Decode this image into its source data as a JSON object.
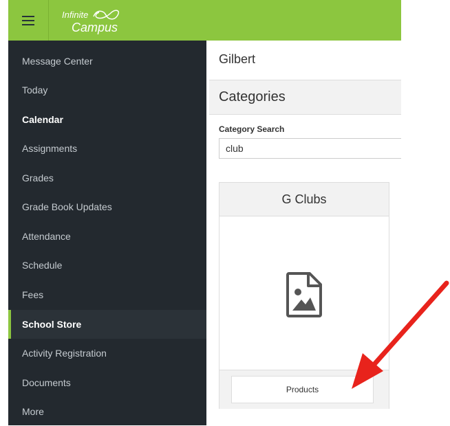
{
  "header": {
    "logo_line1": "Infinite",
    "logo_line2": "Campus",
    "brand_color": "#8cc63f"
  },
  "sidebar": {
    "items": [
      {
        "label": "Message Center"
      },
      {
        "label": "Today"
      },
      {
        "label": "Calendar"
      },
      {
        "label": "Assignments"
      },
      {
        "label": "Grades"
      },
      {
        "label": "Grade Book Updates"
      },
      {
        "label": "Attendance"
      },
      {
        "label": "Schedule"
      },
      {
        "label": "Fees"
      },
      {
        "label": "School Store",
        "active": true
      },
      {
        "label": "Activity Registration"
      },
      {
        "label": "Documents"
      },
      {
        "label": "More"
      }
    ],
    "background_color": "#23292f"
  },
  "main": {
    "school_name": "Gilbert",
    "section_title": "Categories",
    "search": {
      "label": "Category Search",
      "value": "club"
    },
    "card": {
      "title": "G Clubs",
      "image_icon": "image-file-icon",
      "button_label": "Products"
    }
  },
  "annotation": {
    "arrow_color": "#e8231c",
    "arrow_icon": "red-arrow-icon"
  }
}
